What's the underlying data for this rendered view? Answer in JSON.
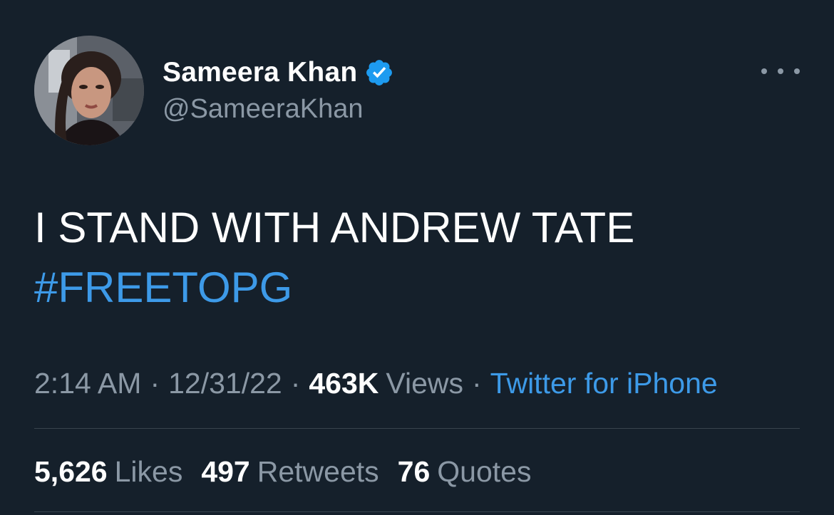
{
  "tweet": {
    "author": {
      "display_name": "Sameera Khan",
      "handle": "@SameeraKhan",
      "verified": true,
      "verified_color": "#1d9bf0",
      "avatar_icon": "profile-photo"
    },
    "text_line_1": "I STAND WITH ANDREW TATE",
    "hashtag": "#FREETOPG",
    "meta": {
      "time": "2:14 AM",
      "date": "12/31/22",
      "separator": "·",
      "views_count": "463K",
      "views_label": "Views",
      "source": "Twitter for iPhone"
    },
    "stats": {
      "likes_count": "5,626",
      "likes_label": "Likes",
      "retweets_count": "497",
      "retweets_label": "Retweets",
      "quotes_count": "76",
      "quotes_label": "Quotes"
    }
  },
  "colors": {
    "background": "#15202b",
    "link": "#3d9ae8",
    "muted": "#8b98a5",
    "divider": "#38444d"
  }
}
